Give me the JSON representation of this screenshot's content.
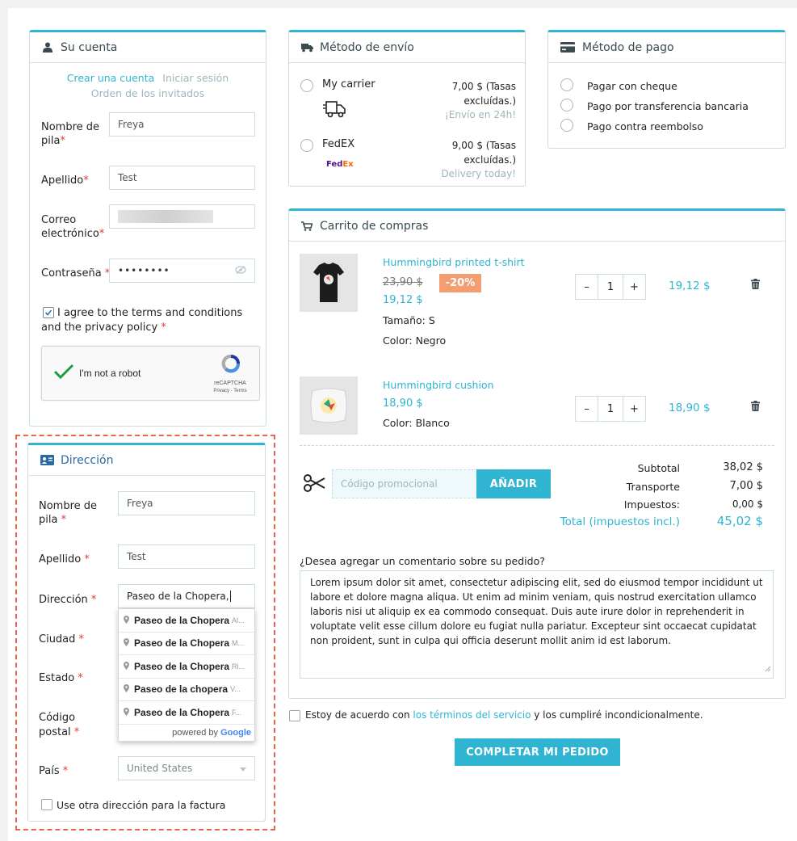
{
  "account": {
    "title": "Su cuenta",
    "tab_create": "Crear una cuenta",
    "tab_login": "Iniciar sesión",
    "tab_guest": "Orden de los invitados",
    "first_name_label": "Nombre de pila",
    "first_name_value": "Freya",
    "last_name_label": "Apellido",
    "last_name_value": "Test",
    "email_label": "Correo electrónico",
    "password_label": "Contraseña",
    "password_value": "••••••••",
    "terms_text": "I agree to the terms and conditions and the privacy policy",
    "captcha_label": "I'm not a robot",
    "captcha_brand": "reCAPTCHA",
    "captcha_links": "Privacy - Terms"
  },
  "shipping": {
    "title": "Método de envío",
    "carriers": [
      {
        "name": "My carrier",
        "price": "7,00 $ (Tasas excluídas.)",
        "delay": "¡Envío en 24h!"
      },
      {
        "name": "FedEX",
        "price": "9,00 $ (Tasas excluídas.)",
        "delay": "Delivery today!",
        "logo_fed": "Fed",
        "logo_ex": "Ex"
      }
    ]
  },
  "payment": {
    "title": "Método de pago",
    "options": [
      "Pagar con cheque",
      "Pago por transferencia bancaria",
      "Pago contra reembolso"
    ]
  },
  "cart": {
    "title": "Carrito de compras",
    "items": [
      {
        "name": "Hummingbird printed t-shirt",
        "old_price": "23,90 $",
        "discount": "-20%",
        "price": "19,12 $",
        "size": "Tamaño: S",
        "color": "Color: Negro",
        "qty": "1",
        "total": "19,12 $"
      },
      {
        "name": "Hummingbird cushion",
        "price": "18,90 $",
        "color": "Color: Blanco",
        "qty": "1",
        "total": "18,90 $"
      }
    ],
    "promo_placeholder": "Código promocional",
    "promo_button": "AÑADIR",
    "subtotal_label": "Subtotal",
    "subtotal_value": "38,02 $",
    "shipping_label": "Transporte",
    "shipping_value": "7,00 $",
    "taxes_label": "Impuestos:",
    "taxes_value": "0,00 $",
    "total_label": "Total (impuestos incl.)",
    "total_value": "45,02 $",
    "comment_label": "¿Desea agregar un comentario sobre su pedido?",
    "comment_text": "Lorem ipsum dolor sit amet, consectetur adipiscing elit, sed do eiusmod tempor incididunt ut labore et dolore magna aliqua. Ut enim ad minim veniam, quis nostrud exercitation ullamco laboris nisi ut aliquip ex ea commodo consequat. Duis aute irure dolor in reprehenderit in voluptate velit esse cillum dolore eu fugiat nulla pariatur. Excepteur sint occaecat cupidatat non proident, sunt in culpa qui officia deserunt mollit anim id est laborum."
  },
  "terms_agree": {
    "before": "Estoy de acuerdo con ",
    "link": "los términos del servicio",
    "after": " y los cumpliré incondicionalmente."
  },
  "complete_button": "COMPLETAR MI PEDIDO",
  "address": {
    "title": "Dirección",
    "first_name_label": "Nombre de pila",
    "first_name_value": "Freya",
    "last_name_label": "Apellido",
    "last_name_value": "Test",
    "address_label": "Dirección",
    "address_value": "Paseo de la Chopera,",
    "city_label": "Ciudad",
    "state_label": "Estado",
    "zip_label": "Código postal",
    "country_label": "País",
    "country_value": "United States",
    "alt_billing": "Use otra dirección para la factura",
    "suggestions": [
      {
        "main": "Paseo de la Chopera",
        "sub": "Al..."
      },
      {
        "main": "Paseo de la Chopera",
        "sub": "M..."
      },
      {
        "main": "Paseo de la Chopera",
        "sub": "Ri..."
      },
      {
        "main": "Paseo de la chopera",
        "sub": "V..."
      },
      {
        "main": "Paseo de la Chopera",
        "sub": "F..."
      }
    ],
    "powered_by": "powered by",
    "google": "Google"
  },
  "colors": {
    "accent": "#2fb5d2",
    "discount": "#f39d72",
    "required": "#e33b3b",
    "highlight_border": "#e8634a"
  }
}
